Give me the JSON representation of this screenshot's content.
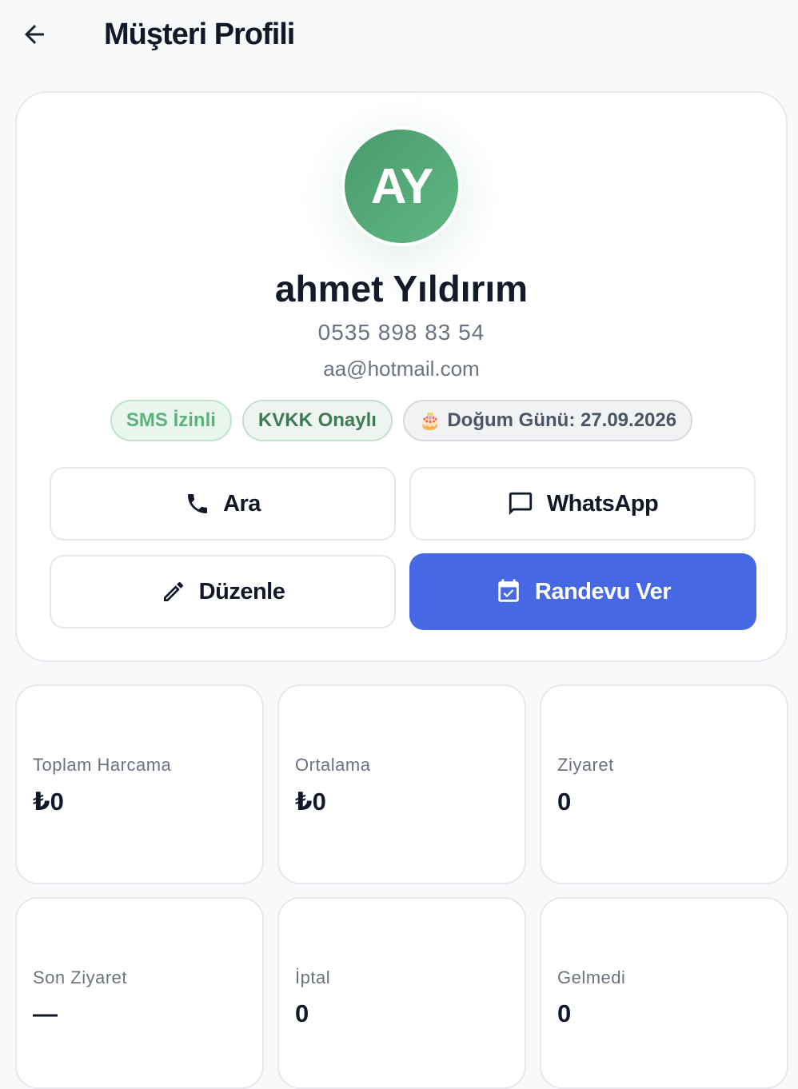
{
  "header": {
    "title": "Müşteri Profili",
    "back_icon": "arrow-left-icon"
  },
  "profile": {
    "initials": "AY",
    "name": "ahmet Yıldırım",
    "phone": "0535 898 83 54",
    "email": "aa@hotmail.com",
    "avatar_colors": [
      "#4a9a6c",
      "#5fb883"
    ],
    "badges": {
      "sms": "SMS İzinli",
      "kvkk": "KVKK Onaylı",
      "birthday_icon": "🎂",
      "birthday": "Doğum Günü: 27.09.2026"
    }
  },
  "actions": {
    "call": {
      "label": "Ara",
      "icon": "phone-icon"
    },
    "whatsapp": {
      "label": "WhatsApp",
      "icon": "message-icon"
    },
    "edit": {
      "label": "Düzenle",
      "icon": "pencil-icon"
    },
    "appointment": {
      "label": "Randevu Ver",
      "icon": "calendar-check-icon",
      "color": "#4668e3"
    }
  },
  "stats": [
    {
      "label": "Toplam Harcama",
      "value": "₺0"
    },
    {
      "label": "Ortalama",
      "value": "₺0"
    },
    {
      "label": "Ziyaret",
      "value": "0"
    },
    {
      "label": "Son Ziyaret",
      "value": "—"
    },
    {
      "label": "İptal",
      "value": "0"
    },
    {
      "label": "Gelmedi",
      "value": "0"
    }
  ]
}
